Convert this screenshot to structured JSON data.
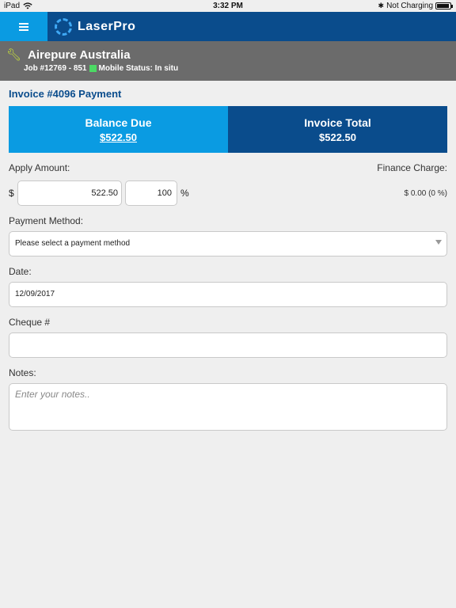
{
  "status_bar": {
    "device": "iPad",
    "time": "3:32 PM",
    "charging": "Not Charging"
  },
  "app": {
    "name": "LaserPro"
  },
  "job": {
    "company": "Airepure Australia",
    "job_number": "Job #12769 - 851",
    "mobile_status": "Mobile Status: In situ",
    "status_color": "#4cd964"
  },
  "invoice": {
    "title": "Invoice #4096 Payment",
    "balance_due_label": "Balance Due",
    "balance_due_value": "$522.50",
    "invoice_total_label": "Invoice Total",
    "invoice_total_value": "$522.50"
  },
  "form": {
    "apply_amount_label": "Apply Amount:",
    "finance_charge_label": "Finance Charge:",
    "currency_symbol": "$",
    "apply_amount_value": "522.50",
    "percent_value": "100",
    "percent_symbol": "%",
    "finance_charge_value": "$ 0.00 (0 %)",
    "payment_method_label": "Payment Method:",
    "payment_method_value": "Please select a payment method",
    "date_label": "Date:",
    "date_value": "12/09/2017",
    "cheque_label": "Cheque #",
    "cheque_value": "",
    "notes_label": "Notes:",
    "notes_placeholder": "Enter your notes.."
  },
  "colors": {
    "primary": "#0a4c8c",
    "accent": "#0a9be2",
    "header_gray": "#6b6b6b"
  }
}
